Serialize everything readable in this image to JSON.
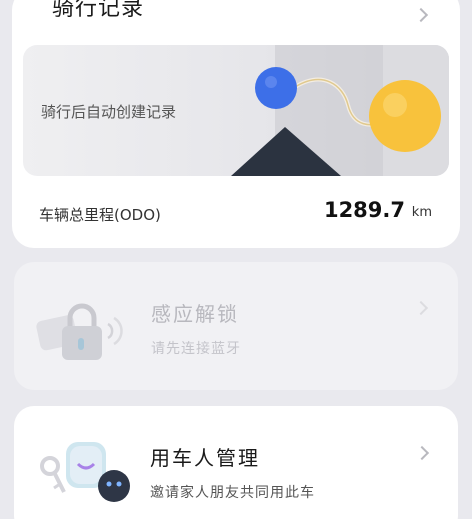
{
  "ride_card": {
    "title": "骑行记录",
    "banner_text": "骑行后自动创建记录",
    "odo_label": "车辆总里程(ODO)",
    "odo_value": "1289.7",
    "odo_unit": "km"
  },
  "unlock_card": {
    "title": "感应解锁",
    "subtitle": "请先连接蓝牙",
    "state": "disabled"
  },
  "users_card": {
    "title": "用车人管理",
    "subtitle": "邀请家人朋友共同用此车"
  },
  "colors": {
    "background": "#e9e9ee",
    "blue_ball": "#3d6fe8",
    "yellow_ball": "#f8c23c",
    "dark_triangle": "#2b3340"
  },
  "icons": [
    "chevron-right-icon",
    "lock-icon",
    "key-icon",
    "robot-icon"
  ]
}
